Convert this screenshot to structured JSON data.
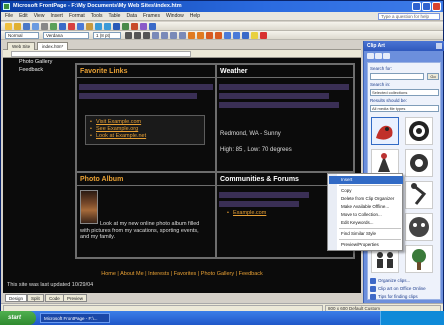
{
  "window": {
    "title": "Microsoft FrontPage - F:\\My Documents\\My Web Sites\\index.htm"
  },
  "menubar": {
    "items": [
      "File",
      "Edit",
      "View",
      "Insert",
      "Format",
      "Tools",
      "Table",
      "Data",
      "Frames",
      "Window",
      "Help"
    ],
    "help_placeholder": "Type a question for help"
  },
  "toolbar": {
    "style_value": "Normal",
    "font_value": "Verdana",
    "size_value": "1 (8 pt)"
  },
  "workspace": {
    "tabs": [
      "Web Site",
      "index.htm*"
    ]
  },
  "page": {
    "leftnav": [
      "Photo Gallery",
      "Feedback"
    ],
    "favorite_links": {
      "heading": "Favorite Links",
      "links": [
        "Visit Example.com",
        "See Example.org",
        "Look at Example.net"
      ]
    },
    "weather": {
      "heading": "Weather",
      "location": "Redmond, WA - Sunny",
      "temps": "High: 85 , Low: 70 degrees"
    },
    "photo_album": {
      "heading": "Photo Album",
      "caption": "Look at my new online photo album filled with pictures from my vacations, sporting events, and my family."
    },
    "communities": {
      "heading": "Communities & Forums",
      "link": "Example.com"
    },
    "footer_links": "Home | About Me | Interests | Favorites | Photo Gallery | Feedback",
    "updated": "This site was last updated 10/29/04"
  },
  "view_tabs": [
    "Design",
    "Split",
    "Code",
    "Preview"
  ],
  "statusbar": {
    "left": "",
    "right": "800 x 600  Default  Custom"
  },
  "taskpane": {
    "title": "Clip Art",
    "search_for_label": "Search for:",
    "search_input": "",
    "go_label": "Go",
    "search_in_label": "Search in:",
    "search_in_value": "Selected collections",
    "results_label": "Results should be:",
    "results_value": "All media file types",
    "links": [
      "Organize clips...",
      "Clip art on Office Online",
      "Tips for finding clips"
    ]
  },
  "context_menu": {
    "items": [
      "Insert",
      "Copy",
      "Delete from Clip Organizer",
      "Make Available Offline...",
      "Move to Collection...",
      "Edit Keywords...",
      "Find Similar Style",
      "Preview/Properties"
    ]
  },
  "taskbar": {
    "start": "start",
    "item": "Microsoft FrontPage - F:\\...",
    "clock": ""
  },
  "colors": {
    "page_bg": "#0b0b0b",
    "accent_orange": "#e8a034",
    "title_blue": "#0a3fa8",
    "taskbar_blue": "#1f57c9",
    "start_green": "#2f8a2f"
  }
}
